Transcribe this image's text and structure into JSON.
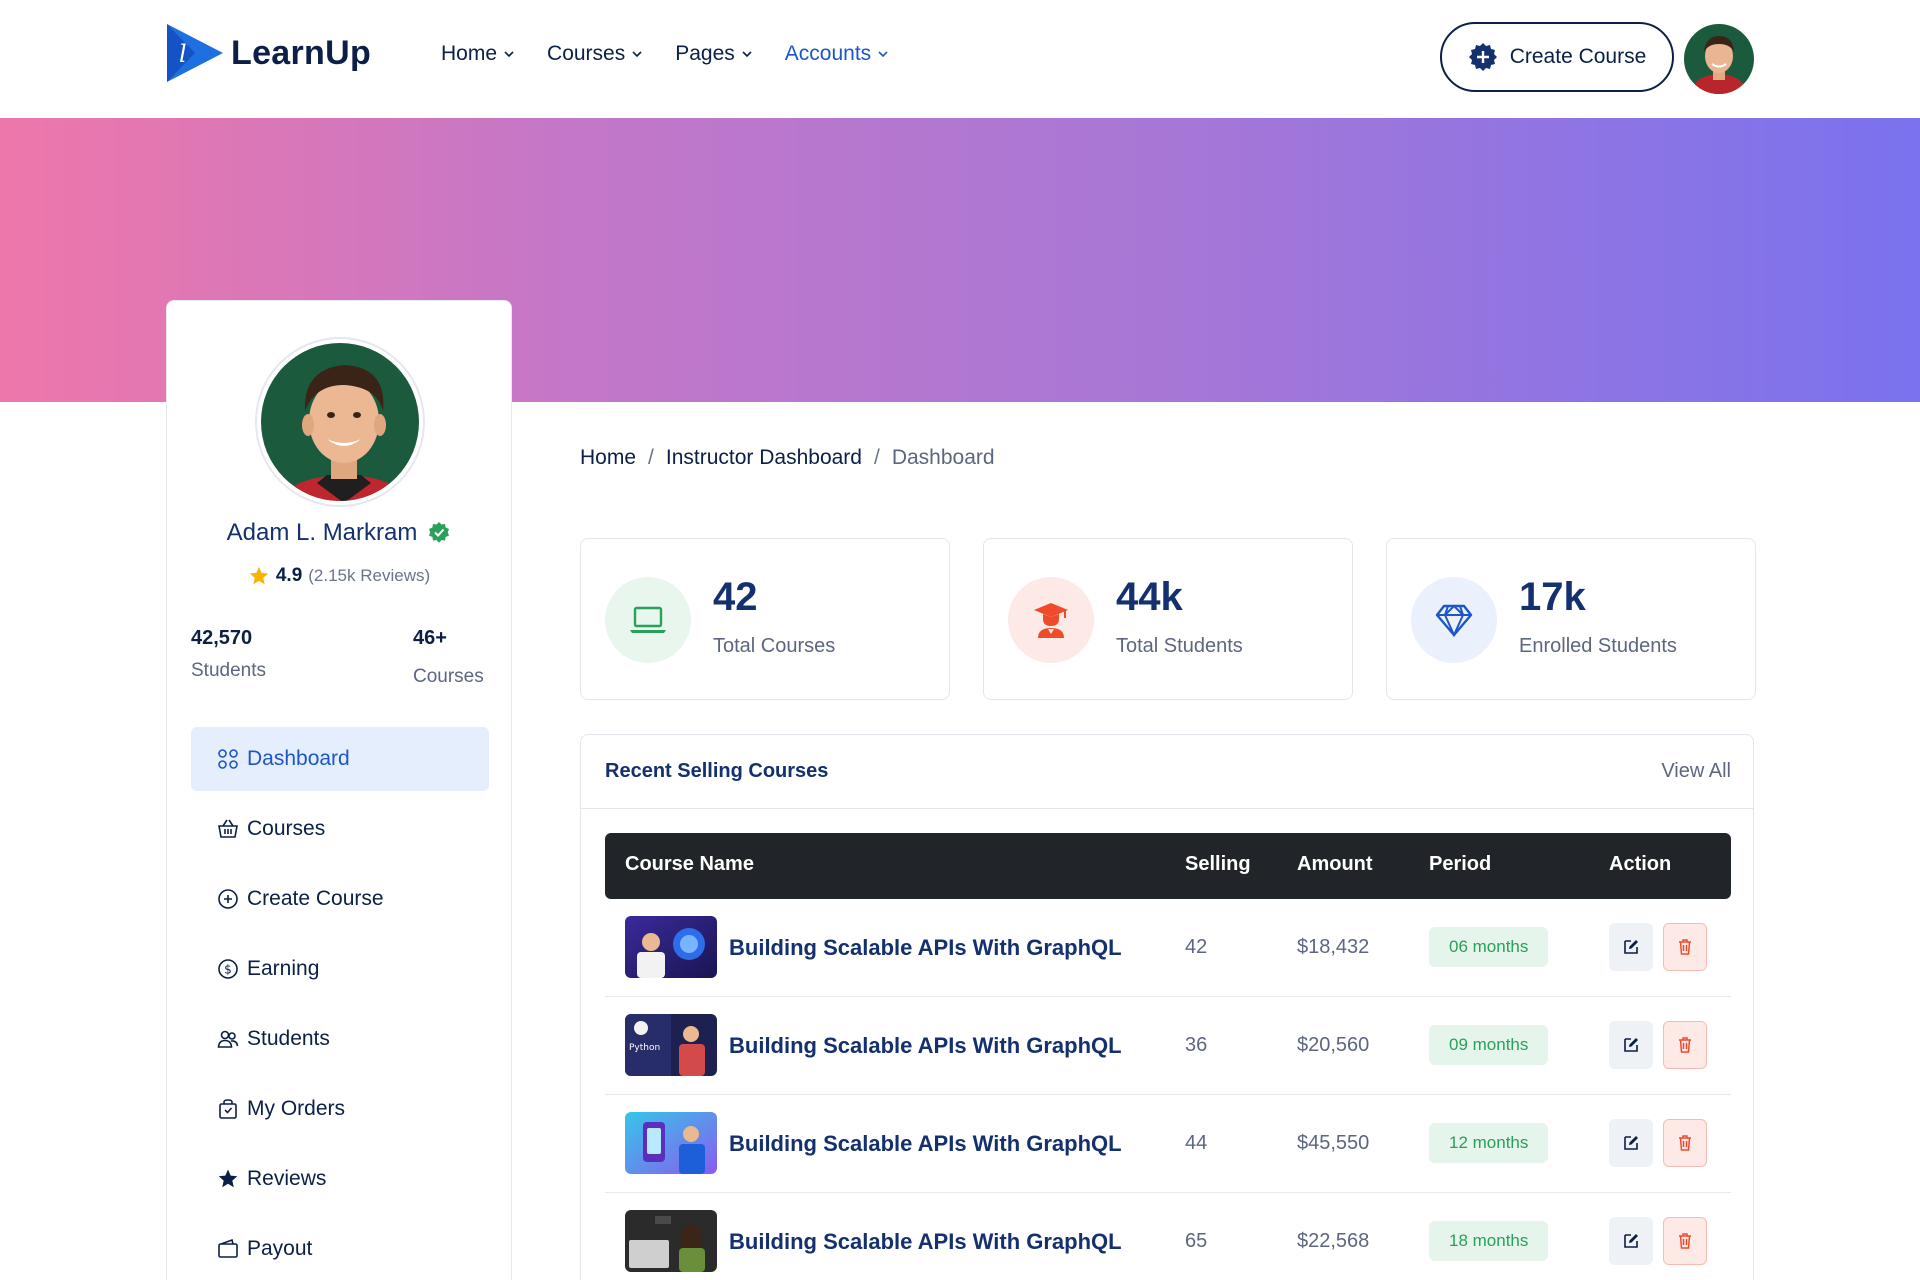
{
  "brand": {
    "name": "LearnUp"
  },
  "nav": {
    "items": [
      {
        "label": "Home"
      },
      {
        "label": "Courses"
      },
      {
        "label": "Pages"
      },
      {
        "label": "Accounts"
      }
    ],
    "create_course": "Create Course"
  },
  "profile": {
    "name": "Adam L. Markram",
    "rating": "4.9",
    "reviews": "(2.15k Reviews)",
    "students_value": "42,570",
    "students_label": "Students",
    "courses_value": "46+",
    "courses_label": "Courses"
  },
  "menu": [
    {
      "label": "Dashboard",
      "icon": "dashboard-icon",
      "active": true
    },
    {
      "label": "Courses",
      "icon": "basket-icon"
    },
    {
      "label": "Create Course",
      "icon": "plus-circle-icon"
    },
    {
      "label": "Earning",
      "icon": "dollar-circle-icon"
    },
    {
      "label": "Students",
      "icon": "users-icon"
    },
    {
      "label": "My Orders",
      "icon": "bag-icon"
    },
    {
      "label": "Reviews",
      "icon": "star-icon"
    },
    {
      "label": "Payout",
      "icon": "wallet-icon"
    }
  ],
  "breadcrumb": [
    "Home",
    "Instructor Dashboard",
    "Dashboard"
  ],
  "stats": [
    {
      "value": "42",
      "label": "Total Courses",
      "icon": "laptop-icon",
      "color": "#2aa05a",
      "bg": "#e8f6ee"
    },
    {
      "value": "44k",
      "label": "Total Students",
      "icon": "graduate-icon",
      "color": "#ee4b2b",
      "bg": "#fde9e6"
    },
    {
      "value": "17k",
      "label": "Enrolled Students",
      "icon": "diamond-icon",
      "color": "#1e55c9",
      "bg": "#eaf1fc"
    }
  ],
  "recent": {
    "title": "Recent Selling Courses",
    "view_all": "View All",
    "columns": [
      "Course Name",
      "Selling",
      "Amount",
      "Period",
      "Action"
    ],
    "rows": [
      {
        "name": "Building Scalable APIs With GraphQL",
        "selling": "42",
        "amount": "$18,432",
        "period": "06 months"
      },
      {
        "name": "Building Scalable APIs With GraphQL",
        "selling": "36",
        "amount": "$20,560",
        "period": "09 months"
      },
      {
        "name": "Building Scalable APIs With GraphQL",
        "selling": "44",
        "amount": "$45,550",
        "period": "12 months"
      },
      {
        "name": "Building Scalable APIs With GraphQL",
        "selling": "65",
        "amount": "$22,568",
        "period": "18 months"
      }
    ]
  },
  "colors": {
    "accent": "#1e55c9",
    "navy": "#0b1f47",
    "banner_start": "#ee77aa",
    "banner_end": "#7a72ee"
  }
}
